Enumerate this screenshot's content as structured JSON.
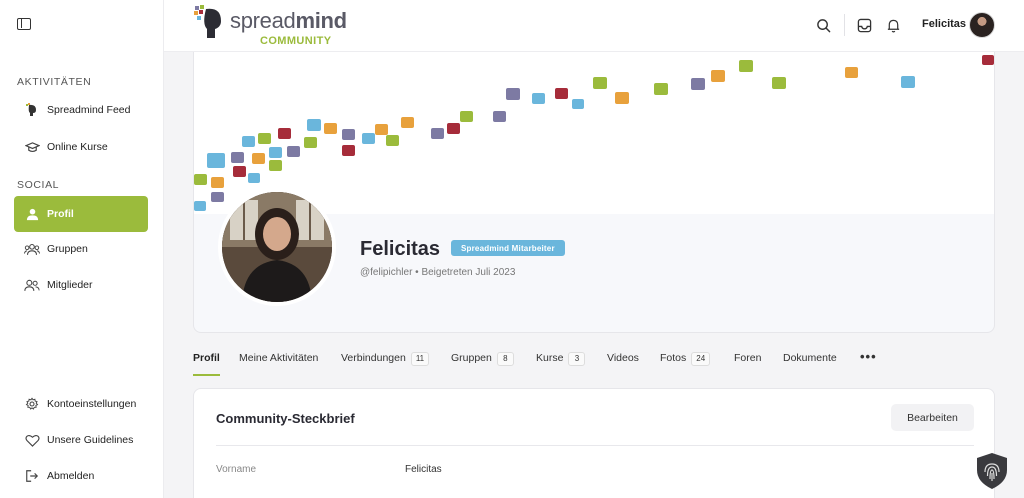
{
  "sidebar": {
    "section_activities": "AKTIVITÄTEN",
    "section_social": "SOCIAL",
    "items": [
      {
        "label": "Spreadmind Feed",
        "icon": "spreadmind-head-icon"
      },
      {
        "label": "Online Kurse",
        "icon": "graduation-cap-icon"
      },
      {
        "label": "Profil",
        "icon": "user-icon",
        "active": true
      },
      {
        "label": "Gruppen",
        "icon": "group-icon"
      },
      {
        "label": "Mitglieder",
        "icon": "members-icon"
      }
    ],
    "bottom_items": [
      {
        "label": "Kontoeinstellungen",
        "icon": "gear-icon"
      },
      {
        "label": "Unsere Guidelines",
        "icon": "heart-icon"
      },
      {
        "label": "Abmelden",
        "icon": "logout-icon"
      }
    ]
  },
  "header": {
    "logo_text_light": "spread",
    "logo_text_bold": "mind",
    "logo_sub": "COMMUNITY",
    "user_name": "Felicitas"
  },
  "profile": {
    "name": "Felicitas",
    "badge": "Spreadmind Mitarbeiter",
    "meta": "@felipichler • Beigetreten Juli 2023"
  },
  "tabs": [
    {
      "label": "Profil",
      "active": true
    },
    {
      "label": "Meine Aktivitäten"
    },
    {
      "label": "Verbindungen",
      "count": "11"
    },
    {
      "label": "Gruppen",
      "count": "8"
    },
    {
      "label": "Kurse",
      "count": "3"
    },
    {
      "label": "Videos"
    },
    {
      "label": "Fotos",
      "count": "24"
    },
    {
      "label": "Foren"
    },
    {
      "label": "Dokumente"
    }
  ],
  "tab_more": "•••",
  "details": {
    "title": "Community-Steckbrief",
    "edit_label": "Bearbeiten",
    "fields": [
      {
        "label": "Vorname",
        "value": "Felicitas"
      }
    ]
  },
  "colors": {
    "accent_green": "#9bbb3c",
    "badge_blue": "#6ab6dc",
    "cover_squares": [
      "#9bbb3c",
      "#6ab6dc",
      "#e8a13c",
      "#a62c3a",
      "#7d7aa3"
    ]
  }
}
